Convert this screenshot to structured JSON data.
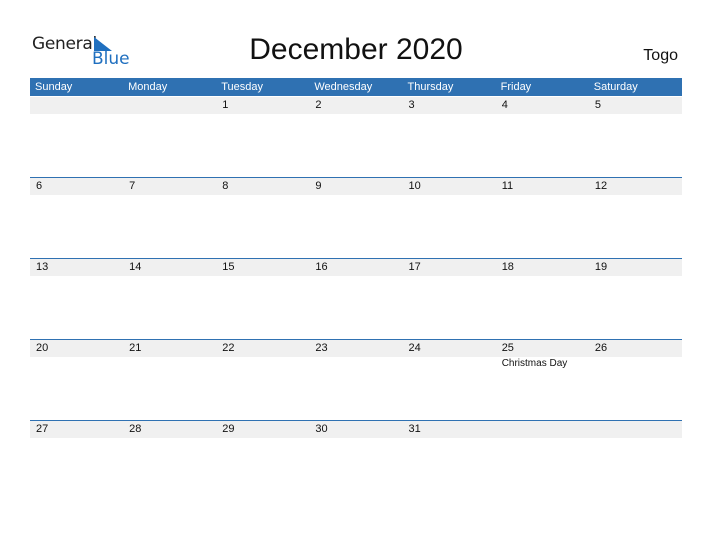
{
  "logo": {
    "line1": "General",
    "line2": "Blue"
  },
  "title": "December 2020",
  "country": "Togo",
  "weekdays": [
    "Sunday",
    "Monday",
    "Tuesday",
    "Wednesday",
    "Thursday",
    "Friday",
    "Saturday"
  ],
  "weeks": [
    [
      "",
      "",
      "1",
      "2",
      "3",
      "4",
      "5"
    ],
    [
      "6",
      "7",
      "8",
      "9",
      "10",
      "11",
      "12"
    ],
    [
      "13",
      "14",
      "15",
      "16",
      "17",
      "18",
      "19"
    ],
    [
      "20",
      "21",
      "22",
      "23",
      "24",
      "25",
      "26"
    ],
    [
      "27",
      "28",
      "29",
      "30",
      "31",
      "",
      ""
    ]
  ],
  "events": {
    "3": {
      "5": "Christmas Day"
    }
  },
  "colors": {
    "accent": "#2f71b2",
    "logo_blue": "#1f6fbf",
    "row_bg": "#f0f0f0"
  }
}
